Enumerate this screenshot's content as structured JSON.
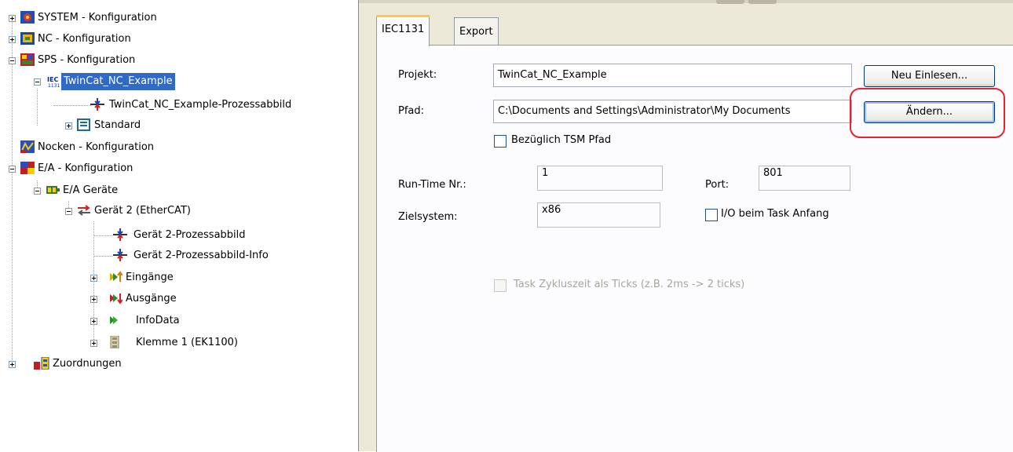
{
  "tree": {
    "items": [
      {
        "label": "SYSTEM - Konfiguration",
        "icon": "system-config-icon",
        "expander": "plus"
      },
      {
        "label": "NC - Konfiguration",
        "icon": "nc-config-icon",
        "expander": "plus"
      },
      {
        "label": "SPS - Konfiguration",
        "icon": "sps-config-icon",
        "expander": "minus"
      },
      {
        "label": "TwinCat_NC_Example",
        "icon": "iec-project-icon",
        "expander": "minus",
        "selected": true
      },
      {
        "label": "TwinCat_NC_Example-Prozessabbild",
        "icon": "process-image-icon"
      },
      {
        "label": "Standard",
        "icon": "task-icon",
        "expander": "plus"
      },
      {
        "label": "Nocken - Konfiguration",
        "icon": "cam-config-icon"
      },
      {
        "label": "E/A - Konfiguration",
        "icon": "io-config-icon",
        "expander": "minus"
      },
      {
        "label": "E/A Geräte",
        "icon": "io-devices-icon",
        "expander": "minus"
      },
      {
        "label": "Gerät 2 (EtherCAT)",
        "icon": "ethercat-device-icon",
        "expander": "minus"
      },
      {
        "label": "Gerät 2-Prozessabbild",
        "icon": "process-image-icon"
      },
      {
        "label": "Gerät 2-Prozessabbild-Info",
        "icon": "process-image-icon"
      },
      {
        "label": "Eingänge",
        "icon": "inputs-icon",
        "expander": "plus"
      },
      {
        "label": "Ausgänge",
        "icon": "outputs-icon",
        "expander": "plus"
      },
      {
        "label": "InfoData",
        "icon": "infodata-icon",
        "expander": "plus"
      },
      {
        "label": "Klemme 1 (EK1100)",
        "icon": "terminal-icon",
        "expander": "plus"
      },
      {
        "label": "Zuordnungen",
        "icon": "mappings-icon",
        "expander": "plus"
      }
    ]
  },
  "tabs": [
    {
      "label": "IEC1131",
      "active": true
    },
    {
      "label": "Export",
      "active": false
    }
  ],
  "form": {
    "projekt_label": "Projekt:",
    "projekt_value": "TwinCat_NC_Example",
    "neu_einlesen_button": "Neu Einlesen...",
    "pfad_label": "Pfad:",
    "pfad_value": "C:\\Documents and Settings\\Administrator\\My Documents",
    "aendern_button": "Ändern...",
    "tsm_checkbox_label": "Bezüglich TSM Pfad",
    "tsm_checked": false,
    "runtime_label": "Run-Time Nr.:",
    "runtime_value": "1",
    "port_label": "Port:",
    "port_value": "801",
    "zielsystem_label": "Zielsystem:",
    "zielsystem_value": "x86",
    "io_checkbox_label": "I/O beim Task Anfang",
    "io_checked": false,
    "ticks_checkbox_label": "Task Zykluszeit als Ticks (z.B. 2ms -> 2 ticks)",
    "ticks_checked": false,
    "ticks_enabled": false
  },
  "colors": {
    "selection": "#316ac5",
    "highlight_ring": "#e8232c",
    "panel_bg": "#ece9d8"
  }
}
